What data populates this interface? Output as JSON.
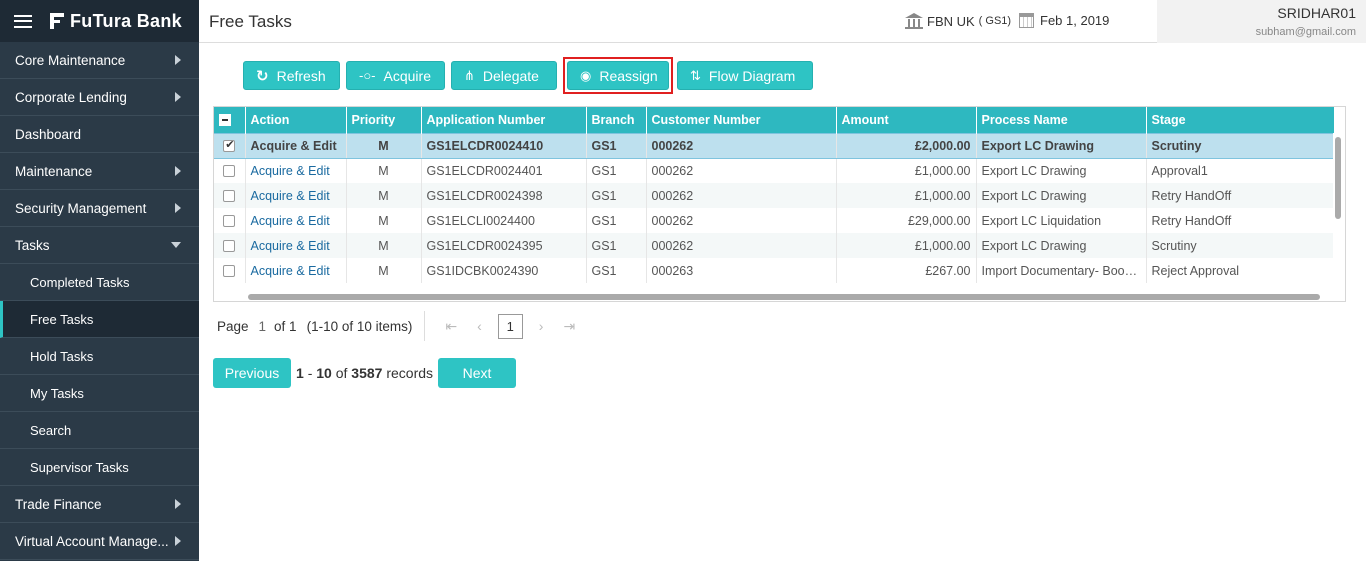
{
  "brand": {
    "name": "FuTura Bank"
  },
  "sidebar": {
    "items": [
      {
        "label": "Core Maintenance",
        "has_arrow": true
      },
      {
        "label": "Corporate Lending",
        "has_arrow": true
      },
      {
        "label": "Dashboard",
        "has_arrow": false
      },
      {
        "label": "Maintenance",
        "has_arrow": true
      },
      {
        "label": "Security Management",
        "has_arrow": true
      },
      {
        "label": "Tasks",
        "expanded": true
      },
      {
        "label": "Trade Finance",
        "has_arrow": true
      },
      {
        "label": "Virtual Account Manage...",
        "has_arrow": true
      }
    ],
    "tasks_sub": [
      {
        "label": "Completed Tasks"
      },
      {
        "label": "Free Tasks",
        "active": true
      },
      {
        "label": "Hold Tasks"
      },
      {
        "label": "My Tasks"
      },
      {
        "label": "Search"
      },
      {
        "label": "Supervisor Tasks"
      }
    ]
  },
  "header": {
    "title": "Free Tasks",
    "entity_name": "FBN UK",
    "entity_code": "( GS1)",
    "date": "Feb 1, 2019",
    "user": "SRIDHAR01",
    "email": "subham@gmail.com"
  },
  "toolbar": {
    "refresh": "Refresh",
    "acquire": "Acquire",
    "delegate": "Delegate",
    "reassign": "Reassign",
    "flow_diagram": "Flow Diagram"
  },
  "table": {
    "columns": [
      "Action",
      "Priority",
      "Application Number",
      "Branch",
      "Customer Number",
      "Amount",
      "Process Name",
      "Stage"
    ],
    "rows": [
      {
        "action": "Acquire & Edit",
        "priority": "M",
        "app": "GS1ELCDR0024410",
        "branch": "GS1",
        "customer": "000262",
        "amount": "£2,000.00",
        "process": "Export LC Drawing",
        "stage": "Scrutiny"
      },
      {
        "action": "Acquire & Edit",
        "priority": "M",
        "app": "GS1ELCDR0024401",
        "branch": "GS1",
        "customer": "000262",
        "amount": "£1,000.00",
        "process": "Export LC Drawing",
        "stage": "Approval1"
      },
      {
        "action": "Acquire & Edit",
        "priority": "M",
        "app": "GS1ELCDR0024398",
        "branch": "GS1",
        "customer": "000262",
        "amount": "£1,000.00",
        "process": "Export LC Drawing",
        "stage": "Retry HandOff"
      },
      {
        "action": "Acquire & Edit",
        "priority": "M",
        "app": "GS1ELCLI0024400",
        "branch": "GS1",
        "customer": "000262",
        "amount": "£29,000.00",
        "process": "Export LC Liquidation",
        "stage": "Retry HandOff"
      },
      {
        "action": "Acquire & Edit",
        "priority": "M",
        "app": "GS1ELCDR0024395",
        "branch": "GS1",
        "customer": "000262",
        "amount": "£1,000.00",
        "process": "Export LC Drawing",
        "stage": "Scrutiny"
      },
      {
        "action": "Acquire & Edit",
        "priority": "M",
        "app": "GS1IDCBK0024390",
        "branch": "GS1",
        "customer": "000263",
        "amount": "£267.00",
        "process": "Import Documentary- Booki...",
        "stage": "Reject Approval"
      }
    ]
  },
  "pager": {
    "page_label": "Page",
    "page": "1",
    "of_label": "of 1",
    "items": "(1-10 of 10 items)",
    "current": "1"
  },
  "records": {
    "previous": "Previous",
    "range_start": "1",
    "dash": "-",
    "range_end": "10",
    "of": "of",
    "total": "3587",
    "label": "records",
    "next": "Next"
  }
}
